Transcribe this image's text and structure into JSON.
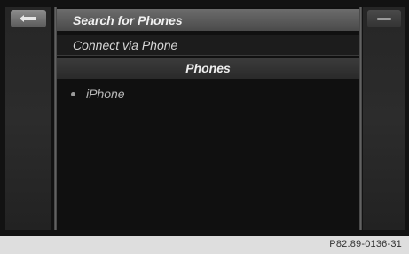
{
  "side_left": {
    "back_icon": "back-arrow-icon"
  },
  "side_right": {
    "icon": "dash-icon"
  },
  "menu": {
    "search_label": "Search for Phones",
    "connect_label": "Connect via Phone"
  },
  "list": {
    "header": "Phones",
    "items": [
      {
        "label": "iPhone"
      }
    ]
  },
  "caption": {
    "code": "P82.89-0136-31"
  }
}
